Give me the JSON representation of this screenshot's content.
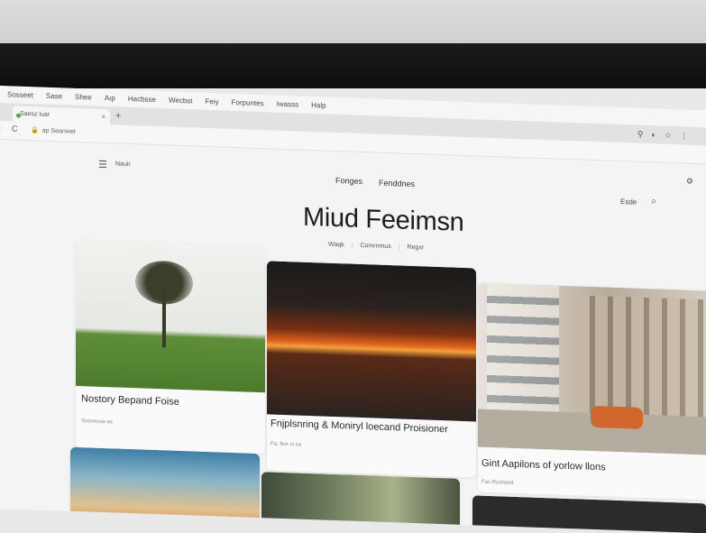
{
  "menubar": [
    "Sosseet",
    "Sase",
    "Shee",
    "Aıp",
    "Hacbsse",
    "Wecbst",
    "Feiy",
    "Forpuntes",
    "Iwasss",
    "Halp"
  ],
  "tab": {
    "title": "Saesz luar",
    "close": "×",
    "new": "+"
  },
  "toolbar": {
    "url": "ap Seanwet",
    "back": "‹",
    "reload": "C",
    "icons": [
      "⚲",
      "◐",
      "☆",
      "⋮"
    ]
  },
  "site": {
    "menu_label": "Nauir",
    "nav": [
      "Fonges",
      "Fenddnes"
    ],
    "save_label": "Esde",
    "title": "Miud Feeimsn",
    "subnav": [
      "Waqk",
      "Comrnmus",
      "Regxr"
    ]
  },
  "cards": [
    {
      "title": "Nostory Bepand Foise",
      "meta": "Sosnecoa as"
    },
    {
      "title": "Fnjplsnring & Moniryl loecand Proisioner",
      "meta": "Fa: Bor ni ea"
    },
    {
      "title": "Gint Aapilons of yorlow llons",
      "meta": "Fas Rumwod"
    }
  ],
  "accent_colors": {
    "tab_dot": "#3db34a",
    "title_text": "#1d1d1d"
  }
}
